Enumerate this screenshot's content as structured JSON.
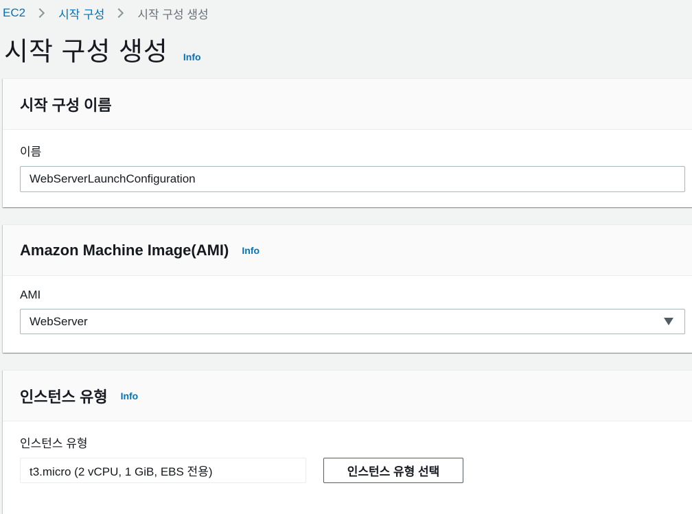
{
  "breadcrumb": {
    "items": [
      "EC2",
      "시작 구성",
      "시작 구성 생성"
    ]
  },
  "page": {
    "title": "시작 구성 생성",
    "info": "Info"
  },
  "name_section": {
    "title": "시작 구성 이름",
    "field_label": "이름",
    "field_value": "WebServerLaunchConfiguration"
  },
  "ami_section": {
    "title": "Amazon Machine Image(AMI)",
    "info": "Info",
    "field_label": "AMI",
    "selected_value": "WebServer"
  },
  "instance_section": {
    "title": "인스턴스 유형",
    "info": "Info",
    "field_label": "인스턴스 유형",
    "field_value": "t3.micro (2 vCPU, 1 GiB, EBS 전용)",
    "choose_button": "인스턴스 유형 선택"
  },
  "colors": {
    "link": "#0073bb",
    "background": "#f2f3f3",
    "text": "#16191f"
  }
}
